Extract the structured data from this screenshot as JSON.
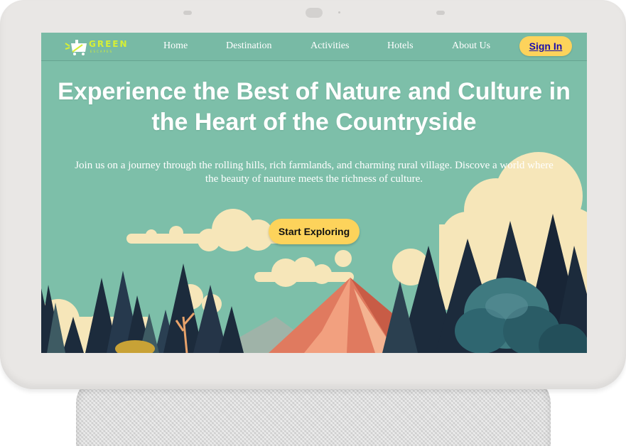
{
  "brand": {
    "name": "GREEN",
    "sub": "ESCAPES",
    "accent": "#d6ef35"
  },
  "nav": {
    "items": [
      {
        "label": "Home"
      },
      {
        "label": "Destination"
      },
      {
        "label": "Activities"
      },
      {
        "label": "Hotels"
      },
      {
        "label": "About Us"
      }
    ],
    "signin_label": "Sign In"
  },
  "hero": {
    "title": "Experience the Best of Nature and Culture in the Heart of the Countryside",
    "subtitle": "Join us on a journey through the rolling hills, rich farmlands, and charming rural village. Discove a world where the beauty of nauture meets the richness of culture.",
    "cta_label": "Start Exploring"
  },
  "colors": {
    "sky": "#7dbfa9",
    "button": "#fdd35b",
    "link": "#1a0dab",
    "tree_dark": "#1c2b3c",
    "mountain": "#e07a5f"
  }
}
